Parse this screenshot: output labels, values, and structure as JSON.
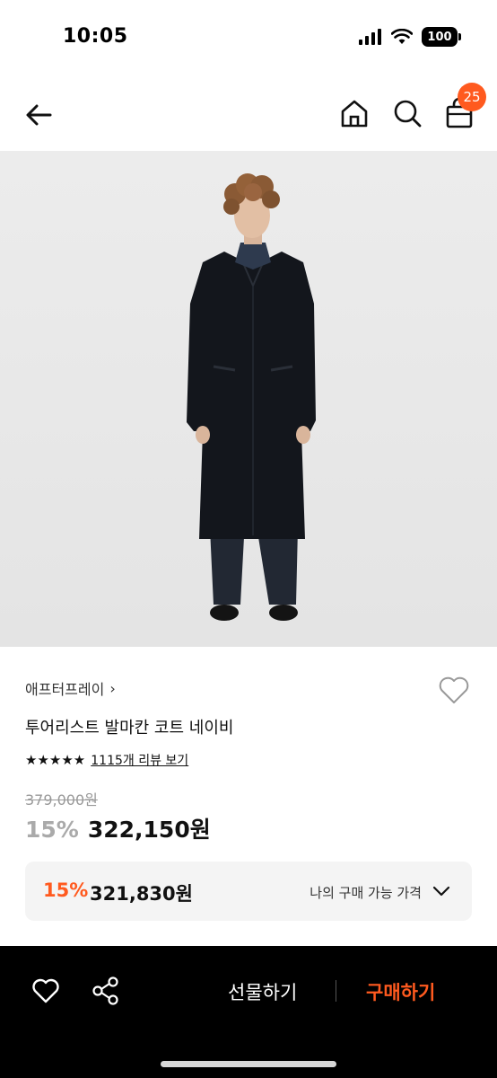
{
  "status_bar": {
    "time": "10:05",
    "battery": "100"
  },
  "header": {
    "cart_count": "25"
  },
  "product": {
    "brand": "애프터프레이",
    "brand_chevron": "›",
    "name": "투어리스트 발마칸 코트 네이비",
    "stars": "★★★★★",
    "review_link": "1115개 리뷰 보기",
    "original_price": "379,000원",
    "discount": "15%",
    "sale_price": "322,150원"
  },
  "my_price": {
    "discount": "15%",
    "price": "321,830원",
    "label": "나의 구매 가능 가격"
  },
  "bottom_bar": {
    "gift_label": "선물하기",
    "buy_label": "구매하기"
  },
  "colors": {
    "accent": "#ff5a1f",
    "bottom_bar": "#000000",
    "image_bg": "#e9e9e9"
  }
}
